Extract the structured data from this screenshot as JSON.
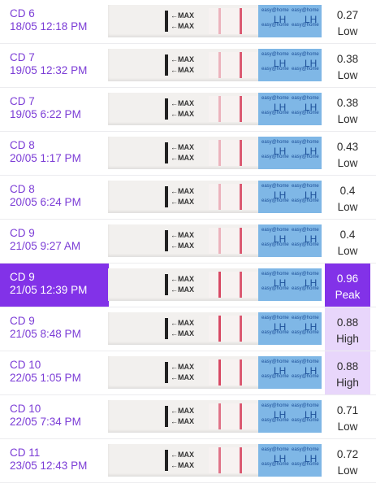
{
  "rows": [
    {
      "cd": "CD 6",
      "datetime": "18/05 12:18 PM",
      "value": "0.27",
      "level": "Low",
      "highlight": "none",
      "test_line": "faint",
      "max_label": "←MAX"
    },
    {
      "cd": "CD 7",
      "datetime": "19/05 12:32 PM",
      "value": "0.38",
      "level": "Low",
      "highlight": "none",
      "test_line": "faint",
      "max_label": "←MAX"
    },
    {
      "cd": "CD 7",
      "datetime": "19/05 6:22 PM",
      "value": "0.38",
      "level": "Low",
      "highlight": "none",
      "test_line": "faint",
      "max_label": "←MAX"
    },
    {
      "cd": "CD 8",
      "datetime": "20/05 1:17 PM",
      "value": "0.43",
      "level": "Low",
      "highlight": "none",
      "test_line": "faint",
      "max_label": "←MAX"
    },
    {
      "cd": "CD 8",
      "datetime": "20/05 6:24 PM",
      "value": "0.4",
      "level": "Low",
      "highlight": "none",
      "test_line": "faint",
      "max_label": "←MAX"
    },
    {
      "cd": "CD 9",
      "datetime": "21/05 9:27 AM",
      "value": "0.4",
      "level": "Low",
      "highlight": "none",
      "test_line": "faint",
      "max_label": "←MAX"
    },
    {
      "cd": "CD 9",
      "datetime": "21/05 12:39 PM",
      "value": "0.96",
      "level": "Peak",
      "highlight": "peak",
      "test_line": "strong",
      "max_label": "←MAX"
    },
    {
      "cd": "CD 9",
      "datetime": "21/05 8:48 PM",
      "value": "0.88",
      "level": "High",
      "highlight": "high",
      "test_line": "strong",
      "max_label": "←MAX"
    },
    {
      "cd": "CD 10",
      "datetime": "22/05 1:05 PM",
      "value": "0.88",
      "level": "High",
      "highlight": "high",
      "test_line": "strong",
      "max_label": "←MAX"
    },
    {
      "cd": "CD 10",
      "datetime": "22/05 7:34 PM",
      "value": "0.71",
      "level": "Low",
      "highlight": "none",
      "test_line": "medium",
      "max_label": "←MAX"
    },
    {
      "cd": "CD 11",
      "datetime": "23/05 12:43 PM",
      "value": "0.72",
      "level": "Low",
      "highlight": "none",
      "test_line": "medium",
      "max_label": "←MAX"
    }
  ],
  "strip_brand": {
    "brand": "easy@home",
    "mark": "LH"
  },
  "colors": {
    "accent_purple": "#8232e8",
    "label_purple": "#7b3cd6",
    "high_bg": "#e8d6fb",
    "strip_band_blue": "#7fb7e6",
    "line_red": "#d63f5c"
  }
}
